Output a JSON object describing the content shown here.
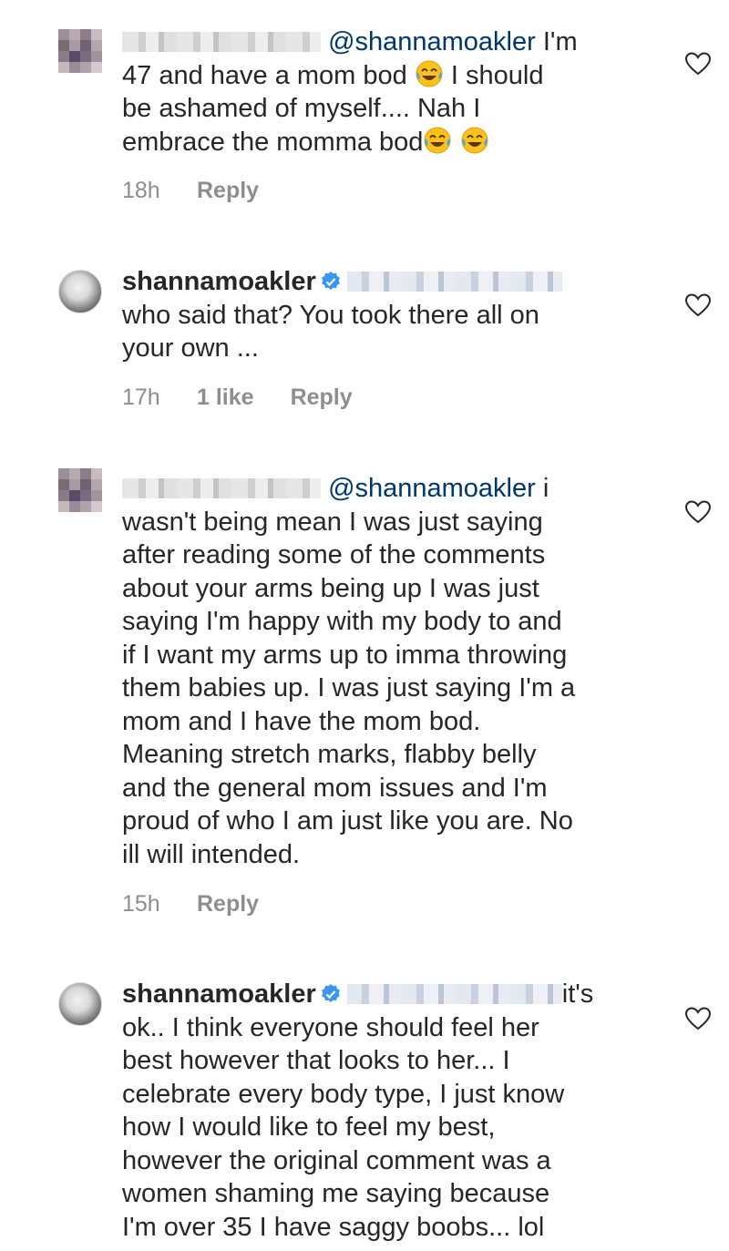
{
  "comments": [
    {
      "username_hidden": true,
      "mention": "@shannamoakler",
      "text_lines": [
        " I'm",
        "47 and have a mom bod",
        " I should",
        "be ashamed of myself.... Nah I",
        "embrace the momma bod"
      ],
      "time": "18h",
      "likes": "",
      "reply_label": "Reply"
    },
    {
      "username": "shannamoakler",
      "text_lines": [
        "who said that? You took there all on",
        "your own ..."
      ],
      "time": "17h",
      "likes": "1 like",
      "reply_label": "Reply"
    },
    {
      "username_hidden": true,
      "mention": "@shannamoakler",
      "text_lines": [
        " i",
        "wasn't being mean I was just saying",
        "after reading some of the comments",
        "about your arms being up I was just",
        "saying I'm happy with my body to and",
        "if I want my arms up to imma throwing",
        "them babies up. I was just saying I'm a",
        "mom and I have the mom bod.",
        "Meaning stretch marks, flabby belly",
        "and the general mom issues and I'm",
        "proud of who I am just like you are. No",
        "ill will intended."
      ],
      "time": "15h",
      "likes": "",
      "reply_label": "Reply"
    },
    {
      "username": "shannamoakler",
      "text_lines": [
        "it's",
        "ok.. I think everyone should feel her",
        "best however that looks to her... I",
        "celebrate every body type, I just know",
        "how I would like to feel my best,",
        "however the original comment was a",
        "women shaming me saying because",
        "I'm over 35 I have saggy boobs... lol"
      ]
    }
  ],
  "icons": {
    "like": "heart-outline-icon",
    "verified": "verified-badge-icon",
    "emoji": "face-with-tears-of-joy"
  },
  "colors": {
    "mention": "#00376b",
    "meta": "#8e8e8e",
    "verified": "#3897f0",
    "text": "#262626"
  }
}
